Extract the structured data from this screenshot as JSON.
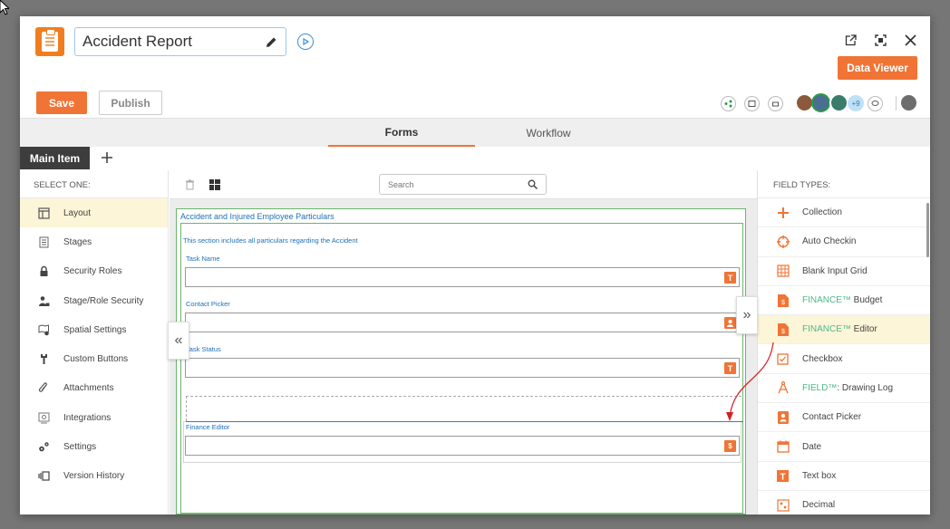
{
  "header": {
    "title": "Accident Report",
    "data_viewer_label": "Data Viewer"
  },
  "actions": {
    "save_label": "Save",
    "publish_label": "Publish"
  },
  "collaborators": {
    "more_count": "+9"
  },
  "tabs": [
    {
      "label": "Forms",
      "active": true
    },
    {
      "label": "Workflow",
      "active": false
    }
  ],
  "item_tab": {
    "label": "Main Item"
  },
  "left_panel": {
    "heading": "SELECT ONE:",
    "items": [
      {
        "label": "Layout",
        "icon": "layout-icon",
        "active": true
      },
      {
        "label": "Stages",
        "icon": "stages-icon"
      },
      {
        "label": "Security Roles",
        "icon": "lock-icon"
      },
      {
        "label": "Stage/Role Security",
        "icon": "user-lock-icon"
      },
      {
        "label": "Spatial Settings",
        "icon": "map-gear-icon"
      },
      {
        "label": "Custom Buttons",
        "icon": "wrench-icon"
      },
      {
        "label": "Attachments",
        "icon": "paperclip-icon"
      },
      {
        "label": "Integrations",
        "icon": "integrations-icon"
      },
      {
        "label": "Settings",
        "icon": "gears-icon"
      },
      {
        "label": "Version History",
        "icon": "version-history-icon"
      }
    ]
  },
  "canvas": {
    "search_placeholder": "Search",
    "section_title": "Accident and Injured Employee Particulars",
    "section_description": "This section includes all particulars regarding the Accident",
    "fields": [
      {
        "label": "Task Name",
        "icon": "text-field-icon"
      },
      {
        "label": "Contact Picker",
        "icon": "contact-icon"
      },
      {
        "label": "Task Status",
        "icon": "text-field-icon"
      },
      {
        "label": "Finance Editor",
        "icon": "finance-doc-icon"
      }
    ]
  },
  "right_panel": {
    "heading": "FIELD TYPES:",
    "items": [
      {
        "label": "Collection",
        "icon": "plus-icon"
      },
      {
        "label": "Auto Checkin",
        "icon": "crosshair-icon"
      },
      {
        "label": "Blank Input Grid",
        "icon": "grid-icon"
      },
      {
        "brand": "FINANCE™",
        "label": " Budget",
        "icon": "finance-doc-icon"
      },
      {
        "brand": "FINANCE™",
        "label": " Editor",
        "icon": "finance-doc-icon",
        "active": true
      },
      {
        "label": "Checkbox",
        "icon": "checkbox-icon"
      },
      {
        "brand": "FIELD™",
        "label": ": Drawing Log",
        "icon": "compass-icon"
      },
      {
        "label": "Contact Picker",
        "icon": "contact-icon"
      },
      {
        "label": "Date",
        "icon": "calendar-icon"
      },
      {
        "label": "Text box",
        "icon": "text-field-icon"
      },
      {
        "label": "Decimal",
        "icon": "decimal-icon"
      }
    ]
  },
  "colors": {
    "accent": "#f07435",
    "link_blue": "#1f6fb5",
    "section_green": "#6cb56c",
    "highlight": "#fdf5d8"
  }
}
